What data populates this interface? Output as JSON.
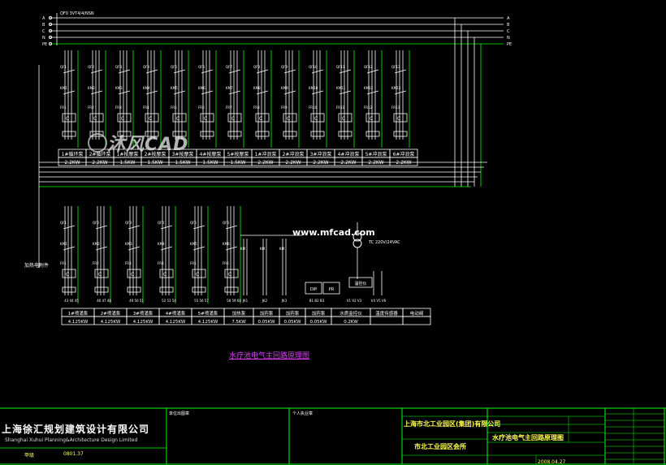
{
  "colors": {
    "background": "#000000",
    "wire_white": "#ffffff",
    "wire_green": "#00ff00",
    "label_yellow": "#ffff55",
    "frame_green": "#00ff00",
    "caption_magenta": "#e040ff"
  },
  "diagram": {
    "caption": "水疗池电气主回路原理图",
    "top_bus_tag": "QF0 3VT4/4/NSN",
    "bus_labels_right": [
      "A",
      "B",
      "C",
      "N",
      "PE"
    ],
    "aux_label": "加热电附件",
    "row1_loads": [
      {
        "name": "1#循环泵",
        "power": "2.2KW"
      },
      {
        "name": "2#循环泵",
        "power": "2.2KW"
      },
      {
        "name": "1#按摩泵",
        "power": "1.5KW"
      },
      {
        "name": "2#按摩泵",
        "power": "1.5KW"
      },
      {
        "name": "3#按摩泵",
        "power": "1.5KW"
      },
      {
        "name": "4#按摩泵",
        "power": "1.5KW"
      },
      {
        "name": "5#按摩泵",
        "power": "1.5KW"
      },
      {
        "name": "1#冲浪泵",
        "power": "2.2KW"
      },
      {
        "name": "2#冲浪泵",
        "power": "2.2KW"
      },
      {
        "name": "3#冲浪泵",
        "power": "2.2KW"
      },
      {
        "name": "4#冲浪泵",
        "power": "2.2KW"
      },
      {
        "name": "5#冲浪泵",
        "power": "2.2KW"
      },
      {
        "name": "6#冲浪泵",
        "power": "2.2KW"
      }
    ],
    "row2_loads": [
      {
        "name": "1#喷涌泵",
        "power": "4.125KW"
      },
      {
        "name": "2#喷涌泵",
        "power": "4.125KW"
      },
      {
        "name": "3#喷涌泵",
        "power": "4.125KW"
      },
      {
        "name": "4#喷涌泵",
        "power": "4.125KW"
      },
      {
        "name": "5#喷涌泵",
        "power": "4.125KW"
      },
      {
        "name": "加热泵",
        "power": "7.5KW"
      },
      {
        "name": "加药泵",
        "power": "0.05KW"
      },
      {
        "name": "加药泵",
        "power": "0.05KW"
      },
      {
        "name": "加药泵",
        "power": "0.05KW"
      },
      {
        "name": "水质监控仪",
        "power": "0.2KW"
      },
      {
        "name": "温度传感器",
        "power": ""
      },
      {
        "name": "电动阀",
        "power": ""
      }
    ],
    "row2_terminals": [
      "43 44 45",
      "46 47 48",
      "49 50 51",
      "52 53 54",
      "55 56 57",
      "58 59 60",
      "JK1",
      "JK2",
      "JK3",
      "B1 B2 B3",
      "V1 V2 V3",
      "V4 V5 V6"
    ],
    "ctrl_boxes": [
      "DIP",
      "PR",
      "温控仪"
    ],
    "transformer_label": "TC 220V/24VAC"
  },
  "watermark": {
    "brand": "沐风CAD",
    "site": "www.mfcad.com"
  },
  "title_block": {
    "company_cn": "上海徐汇规划建筑设计有限公司",
    "company_en": "Shanghai Xuhui Planning&Architecture Design Limited",
    "unit_label": "单位出图章",
    "personal_label": "个人执业章",
    "client": "上海市北工业园区(集团)有限公司",
    "project": "市北工业园区会所",
    "drawing_name": "水疗池电气主回路原理图",
    "date": "2008.04.27",
    "scale_label": "甲级",
    "scale_value": "0801.37"
  }
}
